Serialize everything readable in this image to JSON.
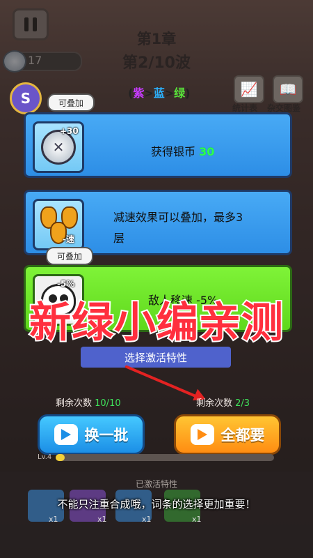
{
  "hud": {
    "chapter": "第1章",
    "wave": "第2/10波",
    "coins": "17",
    "badge": "S",
    "rarity_purple": "紫",
    "rarity_blue": "蓝",
    "rarity_green": "绿",
    "stats_label": "统计表",
    "codex_label": "杂交图鉴"
  },
  "cards": [
    {
      "tag": "可叠加",
      "icon_label": "+30",
      "text": "获得银币 ",
      "value": "30"
    },
    {
      "icon_label": "-速",
      "text_line1": "减速效果可以叠加，最多3",
      "text_line2": "层"
    },
    {
      "tag": "可叠加",
      "icon_label": "-5%",
      "text": "敌人移速 -5%"
    }
  ],
  "overlay_title": "新绿小编亲测",
  "select_prompt": "选择激活特性",
  "left_remaining": {
    "label": "剩余次数 ",
    "value": "10/10"
  },
  "right_remaining": {
    "label": "剩余次数 ",
    "value": "2/3"
  },
  "buttons": {
    "refresh": "换一批",
    "take_all": "全都要"
  },
  "level": {
    "label": "Lv.4",
    "progress": 0.04
  },
  "bottom": {
    "active_label": "已激活特性",
    "slot_counts": [
      "x1",
      "x1",
      "x1",
      "x1"
    ],
    "subtitle": "不能只注重合成哦，词条的选择更加重要！"
  },
  "colors": {
    "card_blue": "#3a9ef0",
    "card_green": "#6ee42a",
    "overlay_red": "#ff2f3e",
    "accent_green": "#3fe05a"
  }
}
